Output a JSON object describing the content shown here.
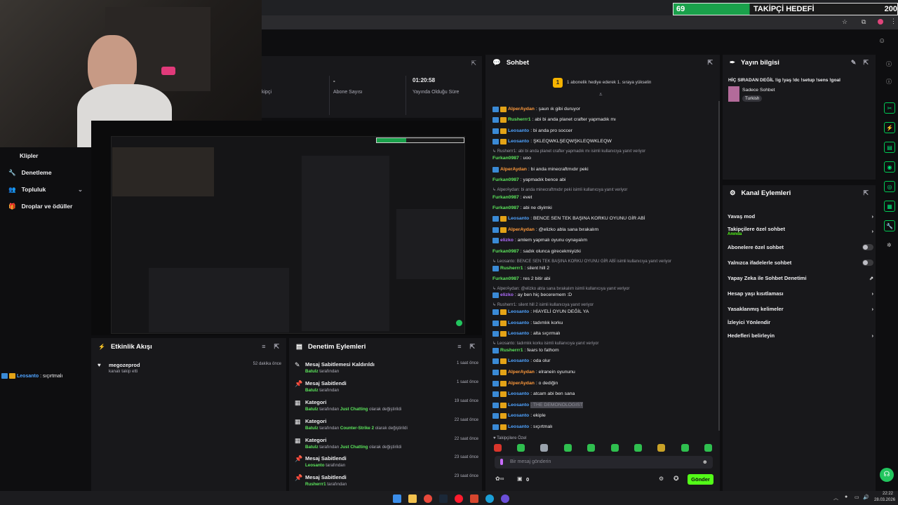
{
  "browser": {
    "goal_count": "69",
    "goal_label": "TAKİPÇİ HEDEFİ",
    "goal_target": "200"
  },
  "sidebar": {
    "items": [
      {
        "label": "Klipler"
      },
      {
        "label": "Denetleme"
      },
      {
        "label": "Topluluk"
      },
      {
        "label": "Droplar ve ödüller"
      }
    ],
    "chat_preview_user": "Leosanto",
    "chat_preview_text": ": sıçırtmalı"
  },
  "stats": {
    "dash": "-",
    "subs_label": "Abone Sayısı",
    "time_value": "01:20:58",
    "time_label": "Yayında Olduğu Süre",
    "partial_label": "kipçi"
  },
  "activity": {
    "title": "Etkinlik Akışı",
    "items": [
      {
        "user": "megozeprod",
        "sub": "kanalı takip etti",
        "time": "52 dakika önce"
      }
    ]
  },
  "mod": {
    "title": "Denetim Eylemleri",
    "items": [
      {
        "title": "Mesaj Sabitlemesi Kaldırıldı",
        "by": "Batulz",
        "suffix": " tarafından",
        "game": "",
        "tail": "",
        "time": "1 saat önce"
      },
      {
        "title": "Mesaj Sabitlendi",
        "by": "Batulz",
        "suffix": " tarafından",
        "game": "",
        "tail": "",
        "time": "1 saat önce"
      },
      {
        "title": "Kategori",
        "by": "Batulz",
        "suffix": " tarafından ",
        "game": "Just Chatting",
        "tail": " olarak değiştirildi",
        "time": "19 saat önce"
      },
      {
        "title": "Kategori",
        "by": "Batulz",
        "suffix": " tarafından ",
        "game": "Counter-Strike 2",
        "tail": " olarak değiştirildi",
        "time": "22 saat önce"
      },
      {
        "title": "Kategori",
        "by": "Batulz",
        "suffix": " tarafından ",
        "game": "Just Chatting",
        "tail": " olarak değiştirildi",
        "time": "22 saat önce"
      },
      {
        "title": "Mesaj Sabitlendi",
        "by": "Leosanto",
        "suffix": " tarafından",
        "game": "",
        "tail": "",
        "time": "23 saat önce"
      },
      {
        "title": "Mesaj Sabitlendi",
        "by": "Rusherrr1",
        "suffix": " tarafından",
        "game": "",
        "tail": "",
        "time": "23 saat önce"
      }
    ]
  },
  "chat": {
    "title": "Sohbet",
    "gift_banner": "1 abonelik hediye ederek 1. sıraya yükselin",
    "followers_only": "Takipçilere Özel",
    "placeholder": "Bir mesaj gönderin",
    "send": "Gönder",
    "points": "0",
    "messages": [
      {
        "type": "msg",
        "user": "AlperAydan",
        "color": "#ff9a3c",
        "text": ": şaun ık gibi duruyor",
        "b": 2
      },
      {
        "type": "msg",
        "user": "Rusherrr1",
        "color": "#5ce65c",
        "text": ": abi bi anda planet crafter yapmadık mı",
        "b": 2
      },
      {
        "type": "msg",
        "user": "Leosanto",
        "color": "#4fa3ff",
        "text": ": bi anda pro soccer",
        "b": 2
      },
      {
        "type": "msg",
        "user": "Leosanto",
        "color": "#4fa3ff",
        "text": ": ŞKLEQWKLŞEQWŞKLEQWKLEQW",
        "b": 2
      },
      {
        "type": "reply",
        "text": "Rusherrr1: abi bi anda planet crafter yapmadık mı isimli kullanıcıya yanıt veriyor"
      },
      {
        "type": "msg",
        "user": "Furkan0987",
        "color": "#5ce65c",
        "text": ": uoo",
        "b": 0
      },
      {
        "type": "msg",
        "user": "AlperAydan",
        "color": "#ff9a3c",
        "text": ": bi anda minecraftmıdır peki",
        "b": 1
      },
      {
        "type": "msg",
        "user": "Furkan0987",
        "color": "#5ce65c",
        "text": ": yapmadık bence abi",
        "b": 0
      },
      {
        "type": "reply",
        "text": "AlperAydan: bi anda minecraftmıdır peki isimli kullanıcıya yanıt veriyor"
      },
      {
        "type": "msg",
        "user": "Furkan0987",
        "color": "#5ce65c",
        "text": ": evet",
        "b": 0
      },
      {
        "type": "msg",
        "user": "Furkan0987",
        "color": "#5ce65c",
        "text": ": abi ne diyimki",
        "b": 0
      },
      {
        "type": "msg",
        "user": "Leosanto",
        "color": "#4fa3ff",
        "text": ": BENCE SEN TEK BAŞINA KORKU OYUNU GİR ABİ",
        "b": 2
      },
      {
        "type": "msg",
        "user": "AlperAydan",
        "color": "#ff9a3c",
        "text": ": @elizko abla sana bırakalım",
        "b": 2
      },
      {
        "type": "msg",
        "user": "elizko",
        "color": "#b06cff",
        "text": ": amlem yapmalı oyunu oynayalım",
        "b": 1
      },
      {
        "type": "msg",
        "user": "Furkan0987",
        "color": "#5ce65c",
        "text": ": sadık olunca girecekmiyizki",
        "b": 0
      },
      {
        "type": "reply",
        "text": "Leosanto: BENCE SEN TEK BAŞINA KORKU OYUNU GİR ABİ isimli kullanıcıya yanıt veriyor"
      },
      {
        "type": "msg",
        "user": "Rusherrr1",
        "color": "#5ce65c",
        "text": ": silent hill 2",
        "b": 1
      },
      {
        "type": "msg",
        "user": "Furkan0987",
        "color": "#5ce65c",
        "text": ": res 2 bitir abi",
        "b": 0
      },
      {
        "type": "reply",
        "text": "AlperAydan: @elizko abla sana bırakalım isimli kullanıcıya yanıt veriyor"
      },
      {
        "type": "msg",
        "user": "elizko",
        "color": "#b06cff",
        "text": ": ay ben hiç beceremem :D",
        "b": 1
      },
      {
        "type": "reply",
        "text": "Rusherrr1: silent hill 2 isimli kullanıcıya yanıt veriyor"
      },
      {
        "type": "msg",
        "user": "Leosanto",
        "color": "#4fa3ff",
        "text": ": HİAYELİ OYUN DEĞİL YA",
        "b": 2
      },
      {
        "type": "msg",
        "user": "Leosanto",
        "color": "#4fa3ff",
        "text": ": tadımlık korku",
        "b": 2
      },
      {
        "type": "msg",
        "user": "Leosanto",
        "color": "#4fa3ff",
        "text": ": alta sıçırmalı",
        "b": 2
      },
      {
        "type": "reply",
        "text": "Leosanto: tadımlık korku isimli kullanıcıya yanıt veriyor"
      },
      {
        "type": "msg",
        "user": "Rusherrr1",
        "color": "#5ce65c",
        "text": ": fears to fathom",
        "b": 1
      },
      {
        "type": "msg",
        "user": "Leosanto",
        "color": "#4fa3ff",
        "text": ": oda olur",
        "b": 2
      },
      {
        "type": "msg",
        "user": "AlperAydan",
        "color": "#ff9a3c",
        "text": ": elranein oyununu",
        "b": 2
      },
      {
        "type": "msg",
        "user": "AlperAydan",
        "color": "#ff9a3c",
        "text": ": o dediğin",
        "b": 2
      },
      {
        "type": "msg",
        "user": "Leosanto",
        "color": "#4fa3ff",
        "text": ": atcam abi ben sana",
        "b": 2
      },
      {
        "type": "msg",
        "user": "Leosanto",
        "color": "#4fa3ff",
        "text": ": THE DEMONOLOGIST",
        "b": 2
      },
      {
        "type": "msg",
        "user": "Leosanto",
        "color": "#4fa3ff",
        "text": ": ekiple",
        "b": 2
      },
      {
        "type": "msg",
        "user": "Leosanto",
        "color": "#4fa3ff",
        "text": ": sıçırtmalı",
        "b": 2
      }
    ]
  },
  "streaminfo": {
    "title": "Yayın bilgisi",
    "stream_title": "HİÇ SIRADAN DEĞİL !ig !yaş !dc !setup !sens !goal",
    "category": "Sadece Sohbet",
    "tag": "Turkish"
  },
  "channel_actions": {
    "title": "Kanal Eylemleri",
    "items": [
      {
        "label": "Yavaş mod",
        "sub": "",
        "ctrl": "arrow"
      },
      {
        "label": "Takipçilere özel sohbet",
        "sub": "Anında",
        "ctrl": "arrow"
      },
      {
        "label": "Abonelere özel sohbet",
        "sub": "",
        "ctrl": "toggle"
      },
      {
        "label": "Yalnızca ifadelerle sohbet",
        "sub": "",
        "ctrl": "toggle"
      },
      {
        "label": "Yapay Zeka ile Sohbet Denetimi",
        "sub": "",
        "ctrl": "link"
      },
      {
        "label": "Hesap yaşı kısıtlaması",
        "sub": "",
        "ctrl": "arrow"
      },
      {
        "label": "Yasaklanmış kelimeler",
        "sub": "",
        "ctrl": "arrow"
      },
      {
        "label": "İzleyici Yönlendir",
        "sub": "",
        "ctrl": "none"
      },
      {
        "label": "Hedefleri belirleyin",
        "sub": "",
        "ctrl": "arrow"
      }
    ]
  },
  "taskbar": {
    "time": "22:22",
    "date": "28.03.2026"
  }
}
